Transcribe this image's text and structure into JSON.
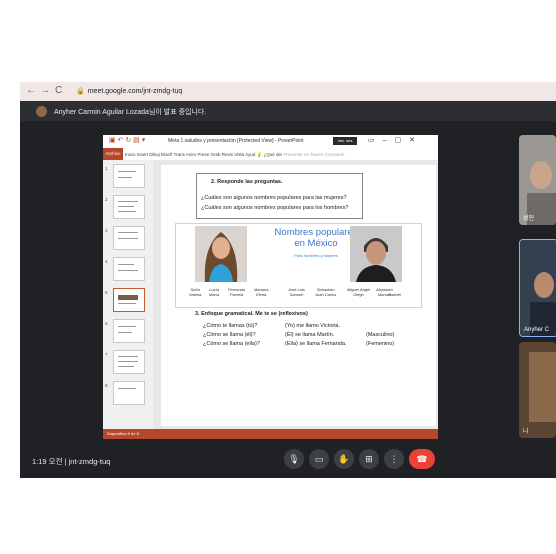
{
  "browser": {
    "url": "meet.google.com/jnt-zmdg-tuq",
    "banner_message": "Anyher Carmin Aguilar Lozada님이 발표 중입니다."
  },
  "powerpoint": {
    "doc_title": "Meta 1 saludos y presentación [Protected View] - PowerPoint",
    "sign_in": "Inic. ses",
    "ribbon_file": "Archivo",
    "ribbon_tabs": [
      "Inicio",
      "Insert",
      "Dibuj",
      "Diseñ",
      "Trans",
      "Anim",
      "Prese",
      "Grab",
      "Revis",
      "Vista",
      "Ayud",
      "¿Qué dei",
      "Presentar en Teams",
      "Compartir"
    ],
    "thumbnail_numbers": [
      "1",
      "2",
      "3",
      "4",
      "5",
      "6",
      "7",
      "8"
    ],
    "status_left": "Diapositiva 5 de 8"
  },
  "slide": {
    "section2": "2.    Responde las preguntas.",
    "q1": "¿Cuáles son algunos nombres populares para las mujeres?",
    "q2": "¿Cuáles son algunos nombres populares para los hombres?",
    "title_line1": "Nombres populares",
    "title_line2": "en México",
    "subtitle": "Para hombres y mujeres",
    "female_names": [
      [
        "Sofía",
        "Valeria"
      ],
      [
        "Lucía",
        "María"
      ],
      [
        "Fernanda",
        "Pamela"
      ],
      [
        "Mariana",
        "Elena"
      ]
    ],
    "male_names": [
      [
        "José Luis",
        "Samuel"
      ],
      [
        "Sebastián",
        "Juan Carlos"
      ],
      [
        "Miguel Ángel",
        "Diego"
      ],
      [
        "Alejandro",
        "Manuel"
      ],
      [
        "",
        "Gabriel"
      ]
    ],
    "section3": "3.    Enfoque gramatical. Me te se (reflexivos)",
    "grammar": [
      {
        "q": "¿Cómo te llamas (tú)?",
        "a": "(Yo) me llamo Victoria.",
        "g": ""
      },
      {
        "q": "¿Cómo se llama (él)?",
        "a": "(Él) se llama Martín.",
        "g": "(Masculino)"
      },
      {
        "q": "¿Cómo se llama (ella)?",
        "a": "(Ella) se llama Fernanda.",
        "g": "(Femenino)"
      }
    ]
  },
  "participants": [
    {
      "label": "성인"
    },
    {
      "label": "Anyher C"
    },
    {
      "label": "나"
    }
  ],
  "meeting": {
    "time": "1:19 오전",
    "code": "jnt-zmdg-tuq"
  },
  "colors": {
    "ppt_red": "#b7472a",
    "end_call": "#ea4335",
    "title_blue": "#3b79c6"
  }
}
